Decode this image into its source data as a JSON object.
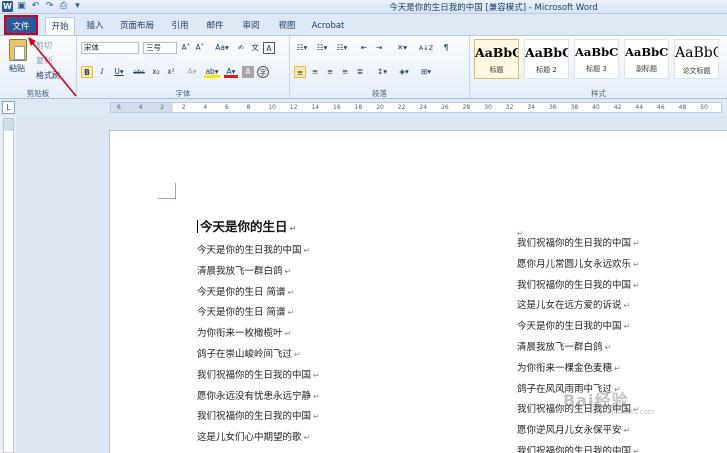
{
  "window": {
    "title": "今天是你的生日我的中国 [兼容模式] - Microsoft Word",
    "app_icon": "W"
  },
  "quick_access": [
    {
      "name": "save-icon",
      "glyph": "▣"
    },
    {
      "name": "undo-icon",
      "glyph": "↶"
    },
    {
      "name": "redo-icon",
      "glyph": "↷"
    },
    {
      "name": "print-preview-icon",
      "glyph": "⎙"
    },
    {
      "name": "customize-icon",
      "glyph": "▾"
    }
  ],
  "tabs": [
    "文件",
    "开始",
    "插入",
    "页面布局",
    "引用",
    "邮件",
    "审阅",
    "视图",
    "Acrobat"
  ],
  "clipboard": {
    "paste": "粘贴",
    "cut": "剪切",
    "copy": "复制",
    "format_painter": "格式刷",
    "group_label": "剪贴板"
  },
  "font": {
    "name": "宋体",
    "size": "三号",
    "grow": "A˄",
    "shrink": "A˅",
    "case": "Aa▾",
    "clear": "✍",
    "phonetic": "文",
    "border": "A",
    "bold": "B",
    "italic": "I",
    "underline": "U▾",
    "strike": "abc",
    "subscript": "x₂",
    "superscript": "x²",
    "effects": "A▾",
    "highlight": "ab▾",
    "color": "A▾",
    "char_shade": "A",
    "enclose": "字",
    "group_label": "字体"
  },
  "paragraph": {
    "bullets": "☷▾",
    "numbering": "☷▾",
    "multilevel": "☷▾",
    "decrease_indent": "⇤",
    "increase_indent": "⇥",
    "chinese_layout": "✕▾",
    "sort": "A↓Z",
    "show_marks": "¶",
    "align_left": "≡",
    "center": "≡",
    "align_right": "≡",
    "justify": "≡",
    "distributed": "≣",
    "line_spacing": "↕▾",
    "shading": "◈▾",
    "borders": "⊞▾",
    "group_label": "段落"
  },
  "styles": {
    "items": [
      {
        "sample": "AaBbC",
        "name": "标题"
      },
      {
        "sample": "AaBbC",
        "name": "标题 2"
      },
      {
        "sample": "AaBbC",
        "name": "标题 3"
      },
      {
        "sample": "AaBbC",
        "name": "副标题"
      },
      {
        "sample": "AaBbC",
        "name": "论文标题"
      }
    ],
    "group_label": "样式"
  },
  "ruler": {
    "numbers": [
      "6",
      "4",
      "2",
      "2",
      "4",
      "6",
      "8",
      "10",
      "12",
      "14",
      "16",
      "18",
      "20",
      "22",
      "24",
      "26",
      "28",
      "30",
      "32",
      "34",
      "36",
      "38",
      "40",
      "42",
      "44",
      "46",
      "48",
      "50"
    ],
    "corner": "L"
  },
  "document": {
    "heading": "今天是你的生日",
    "left_lines": [
      "今天是你的生日我的中国",
      "清晨我放飞一群白鸽",
      "今天是你的生日  简谱",
      "今天是你的生日  简谱",
      "为你衔来一枚橄榄叶",
      "鸽子在崇山峻岭间飞过",
      "我们祝福你的生日我的中国",
      "愿你永远没有忧患永远宁静",
      "我们祝福你的生日我的中国",
      "这是儿女们心中期望的歌"
    ],
    "right_lines": [
      "我们祝福你的生日我的中国",
      "愿你月儿常圆儿女永远欢乐",
      "我们祝福你的生日我的中国",
      "这是儿女在远方爱的诉说",
      "今天是你的生日我的中国",
      "清晨我放飞一群白鸽",
      "为你衔来一棵金色麦穗",
      "鸽子在风风雨雨中飞过",
      "我们祝福你的生日我的中国",
      "愿你逆风月儿女永保平安",
      "我们祝福你的生日我的中国"
    ],
    "paragraph_mark": "↵"
  },
  "watermark": {
    "text": "Bai经验",
    "sub": "jingyan.baidu.com"
  },
  "colors": {
    "file_tab": "#2b5797",
    "highlight_outline": "#d0021b",
    "ribbon_bg": "#e6eef8"
  }
}
